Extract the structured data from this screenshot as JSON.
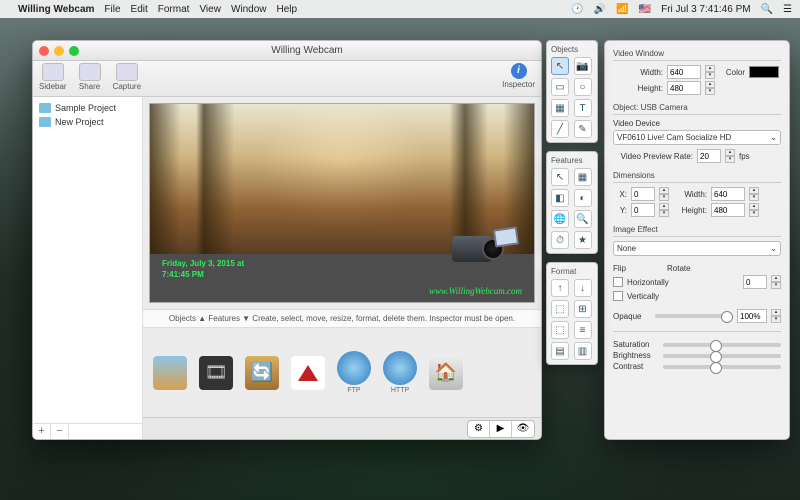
{
  "menubar": {
    "app": "Willing Webcam",
    "items": [
      "File",
      "Edit",
      "Format",
      "View",
      "Window",
      "Help"
    ],
    "clock": "Fri Jul 3  7:41:46 PM"
  },
  "window": {
    "title": "Willing Webcam",
    "toolbar": {
      "sidebar": "Sidebar",
      "share": "Share",
      "capture": "Capture",
      "inspector": "Inspector"
    }
  },
  "sidebar": {
    "items": [
      {
        "label": "Sample Project"
      },
      {
        "label": "New Project"
      }
    ],
    "add": "+",
    "remove": "−"
  },
  "preview": {
    "timestamp_line1": "Friday, July 3, 2015 at",
    "timestamp_line2": "7:41:45 PM",
    "url": "www.WillingWebcam.com"
  },
  "hint": "Objects ▲  Features ▼   Create, select, move, resize, format, delete them.  Inspector must be open.",
  "strip": {
    "ftp": "FTP",
    "http": "HTTP"
  },
  "palette": {
    "objects": "Objects",
    "features": "Features",
    "format": "Format"
  },
  "inspector": {
    "videoWindow": {
      "title": "Video Window",
      "width_label": "Width:",
      "width": "640",
      "height_label": "Height:",
      "height": "480",
      "color_label": "Color"
    },
    "object": {
      "title": "Object: USB Camera",
      "device_label": "Video Device",
      "device": "VF0610 Live! Cam Socialize HD",
      "rate_label": "Video Preview Rate:",
      "rate": "20",
      "fps": "fps"
    },
    "dimensions": {
      "title": "Dimensions",
      "x_label": "X:",
      "x": "0",
      "y_label": "Y:",
      "y": "0",
      "w_label": "Width:",
      "w": "640",
      "h_label": "Height:",
      "h": "480"
    },
    "effect": {
      "title": "Image Effect",
      "value": "None"
    },
    "flip": {
      "flip": "Flip",
      "rotate": "Rotate",
      "horiz": "Horizontally",
      "vert": "Vertically",
      "angle": "0"
    },
    "opaque": {
      "label": "Opaque",
      "value": "100%"
    },
    "adjust": {
      "sat": "Saturation",
      "bri": "Brightness",
      "con": "Contrast"
    }
  }
}
